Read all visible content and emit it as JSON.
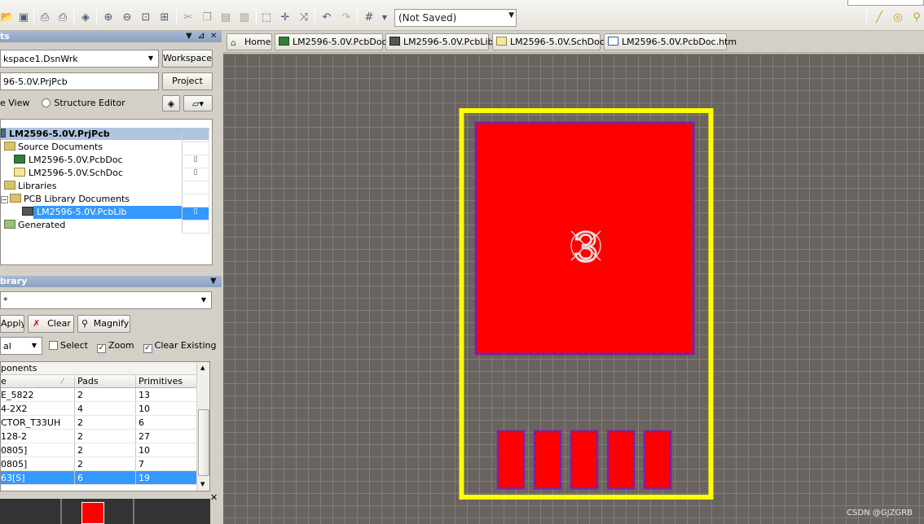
{
  "toolbar": {
    "view_selector": "(Not Saved)",
    "icons": [
      "open-icon",
      "save-icon",
      "print-icon",
      "print-preview-icon",
      "layers-icon",
      "zoom-in-icon",
      "zoom-out-icon",
      "zoom-fit-icon",
      "zoom-area-icon",
      "cut-icon",
      "copy-icon",
      "paste-icon",
      "paste-special-icon",
      "select-icon",
      "move-icon",
      "cross-probe-icon",
      "undo-icon",
      "redo-icon",
      "grid-icon",
      "line-icon",
      "pad-icon",
      "via-icon"
    ]
  },
  "projects_panel": {
    "title": "ts",
    "workspace_value": "kspace1.DsnWrk",
    "workspace_button": "Workspace",
    "project_value": "96-5.0V.PrjPcb",
    "project_button": "Project",
    "view_option_1": "e View",
    "view_option_2": "Structure Editor",
    "tree": {
      "root": "LM2596-5.0V.PrjPcb",
      "items": [
        {
          "label": "Source Documents"
        },
        {
          "label": "LM2596-5.0V.PcbDoc"
        },
        {
          "label": "LM2596-5.0V.SchDoc"
        },
        {
          "label": "Libraries"
        },
        {
          "label": "PCB Library Documents"
        },
        {
          "label": "LM2596-5.0V.PcbLib"
        },
        {
          "label": "Generated"
        }
      ]
    }
  },
  "library_panel": {
    "title": "brary",
    "mask_value": "*",
    "apply_button": "Apply",
    "clear_button": "Clear",
    "magnify_button": "Magnify",
    "mode_value": "al",
    "select_label": "Select",
    "zoom_label": "Zoom",
    "clear_existing_label": "Clear Existing",
    "components_title": "ponents",
    "columns": [
      "e",
      "Pads",
      "Primitives"
    ],
    "rows": [
      {
        "name": "E_5822",
        "pads": "2",
        "primitives": "13"
      },
      {
        "name": "4-2X2",
        "pads": "4",
        "primitives": "10"
      },
      {
        "name": "CTOR_T33UH",
        "pads": "2",
        "primitives": "6"
      },
      {
        "name": "128-2",
        "pads": "2",
        "primitives": "27"
      },
      {
        "name": "0805]",
        "pads": "2",
        "primitives": "10"
      },
      {
        "name": "0805]",
        "pads": "2",
        "primitives": "7"
      },
      {
        "name": "63[S]",
        "pads": "6",
        "primitives": "19"
      }
    ]
  },
  "tabs": [
    {
      "label": "Home"
    },
    {
      "label": "LM2596-5.0V.PcbDoc"
    },
    {
      "label": "LM2596-5.0V.PcbLib"
    },
    {
      "label": "LM2596-5.0V.SchDoc"
    },
    {
      "label": "LM2596-5.0V.PcbDoc.htm"
    }
  ],
  "footprint": {
    "big_pad_designator": "3",
    "small_pad_count": 5,
    "pad_color": "#ff0000",
    "pad_outline": "#8020a0",
    "silkscreen_color": "#ffff00",
    "grid_background": "#6a6460"
  },
  "watermark": "CSDN @GJZGRB"
}
